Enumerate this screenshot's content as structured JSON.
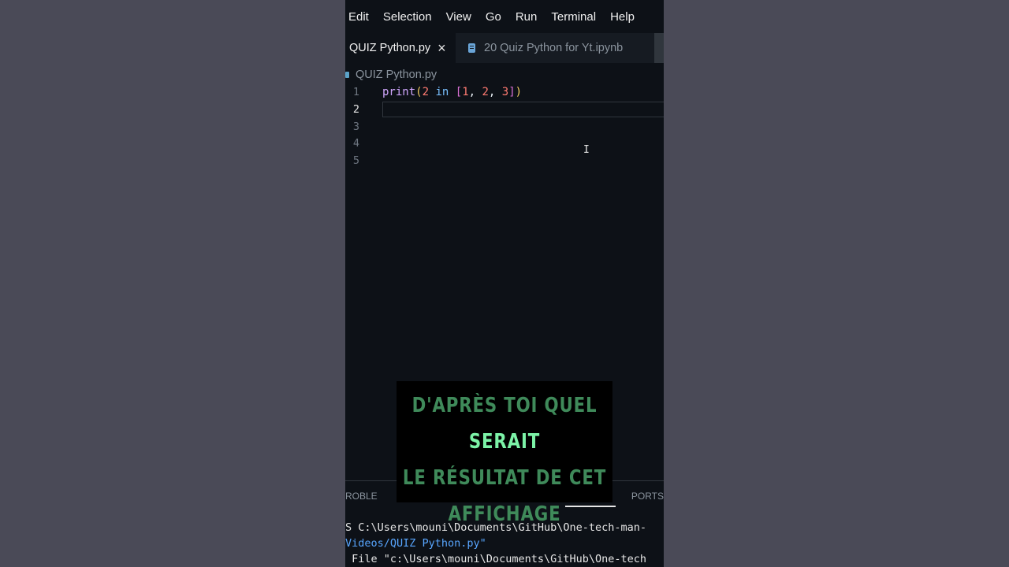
{
  "menu": [
    "Edit",
    "Selection",
    "View",
    "Go",
    "Run",
    "Terminal",
    "Help"
  ],
  "tabs": {
    "active": {
      "label": "QUIZ Python.py",
      "close_icon": "×"
    },
    "inactive": {
      "label": "20 Quiz Python for Yt.ipynb"
    }
  },
  "breadcrumb": "QUIZ Python.py",
  "code": {
    "line_numbers": [
      "1",
      "2",
      "3",
      "4",
      "5"
    ],
    "line1": {
      "fn": "print",
      "open_paren": "(",
      "num1": "2",
      "kw": " in ",
      "open_bracket": "[",
      "a": "1",
      "comma1": ", ",
      "b": "2",
      "comma2": ", ",
      "c": "3",
      "close_bracket": "]",
      "close_paren": ")"
    }
  },
  "panel": {
    "left_tab": "ROBLE",
    "right_tab": "PORTS"
  },
  "terminal": {
    "line1": "S C:\\Users\\mouni\\Documents\\GitHub\\One-tech-man-",
    "line2": "Videos/QUIZ Python.py\"",
    "line3": " File \"c:\\Users\\mouni\\Documents\\GitHub\\One-tech"
  },
  "overlay": {
    "line1_dim": "D'APRÈS TOI QUEL ",
    "line1_bright": "SERAIT",
    "line2": "LE RÉSULTAT DE CET",
    "line3": "AFFICHAGE"
  },
  "colors": {
    "background": "#4a4a57",
    "editor_bg": "#0d1117",
    "overlay_dim": "#3f8a5a",
    "overlay_bright": "#7cf2a7"
  }
}
